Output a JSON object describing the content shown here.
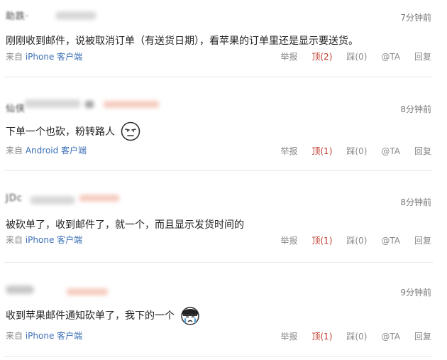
{
  "comments": [
    {
      "time": "7分钟前",
      "text": "刚刚收到邮件，说被取消订单（有送货日期），看苹果的订单里还是显示要送货。",
      "source_prefix": "来自",
      "source_client": "iPhone 客户端",
      "report": "举报",
      "up": "顶(2)",
      "down": "踩(0)",
      "at": "@TA",
      "reply": "回复",
      "emoji": ""
    },
    {
      "time": "8分钟前",
      "text": "下单一个也砍，粉转路人",
      "source_prefix": "来自",
      "source_client": "Android 客户端",
      "report": "举报",
      "up": "顶(1)",
      "down": "踩(0)",
      "at": "@TA",
      "reply": "回复",
      "emoji": "squint-face-icon"
    },
    {
      "time": "8分钟前",
      "text": "被砍单了，收到邮件了，就一个，而且显示发货时间的",
      "source_prefix": "来自",
      "source_client": "iPhone 客户端",
      "report": "举报",
      "up": "顶(1)",
      "down": "踩(0)",
      "at": "@TA",
      "reply": "回复",
      "emoji": ""
    },
    {
      "time": "9分钟前",
      "text": "收到苹果邮件通知砍单了，我下的一个",
      "source_prefix": "来自",
      "source_client": "iPhone 客户端",
      "report": "举报",
      "up": "顶(1)",
      "down": "踩(0)",
      "at": "@TA",
      "reply": "回复",
      "emoji": "crying-bandana-face-icon"
    }
  ],
  "colors": {
    "accent_link": "#3b6fb6",
    "up_vote": "#c0392b",
    "muted": "#888888"
  }
}
